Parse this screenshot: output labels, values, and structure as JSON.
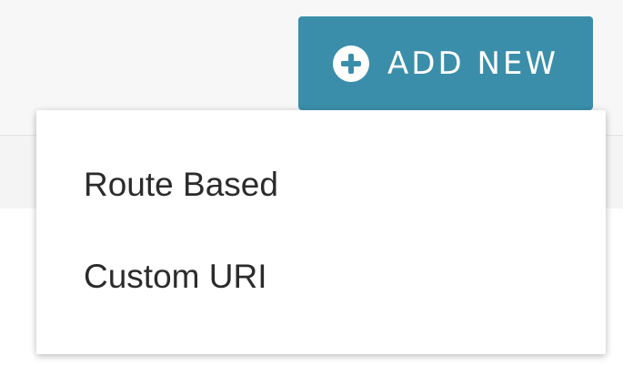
{
  "toolbar": {
    "add_new_label": "ADD NEW",
    "add_new_icon": "plus-circle-icon",
    "accent_color": "#3a8eaa"
  },
  "menu": {
    "items": [
      {
        "label": "Route Based"
      },
      {
        "label": "Custom URI"
      }
    ]
  }
}
